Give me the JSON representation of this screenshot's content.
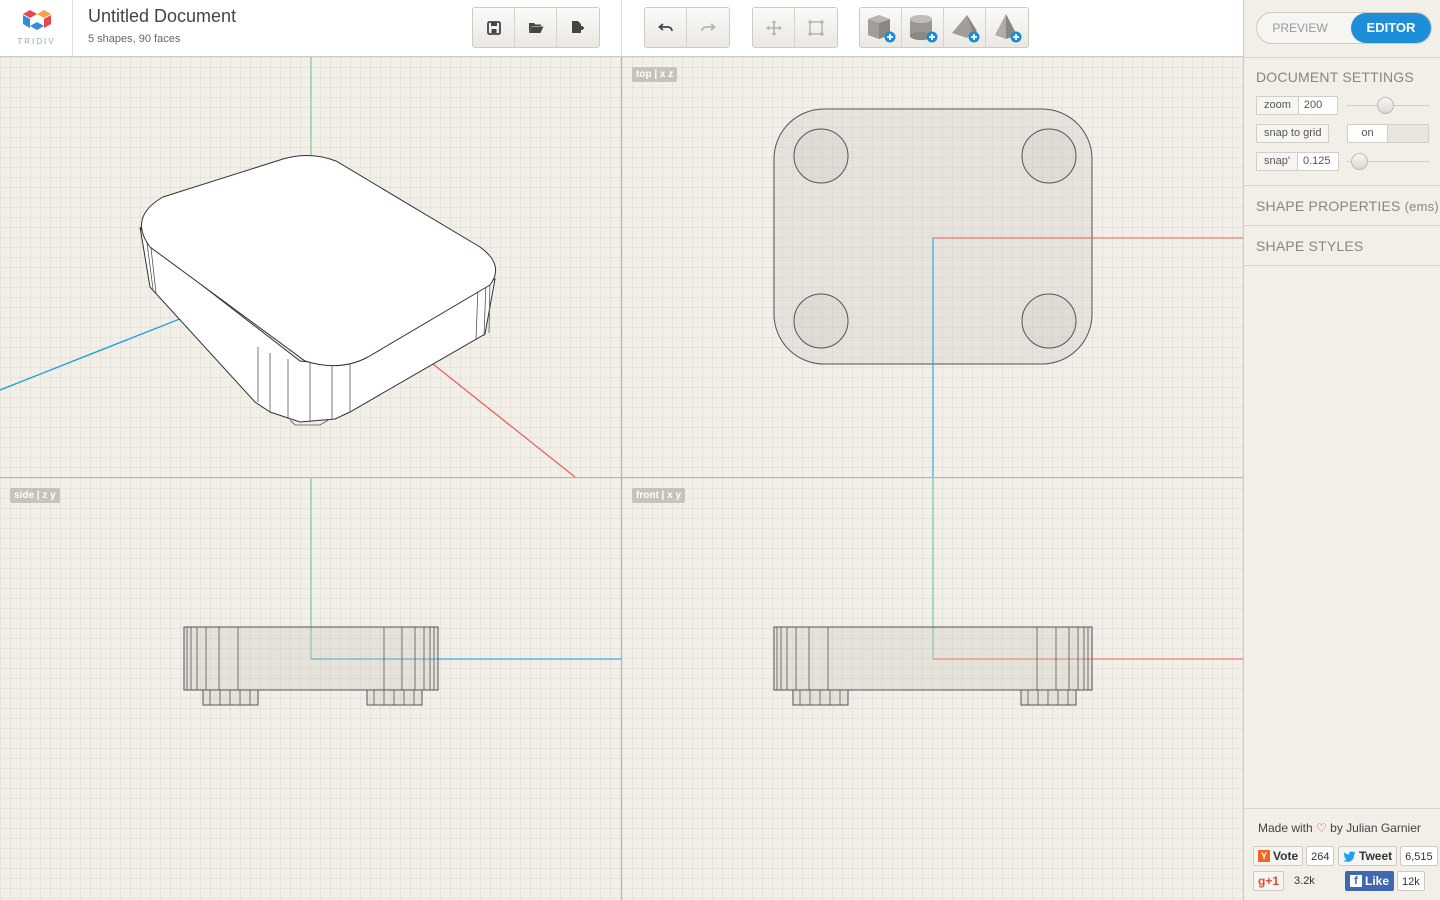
{
  "app": {
    "logo_text": "TRIDIV",
    "document_title": "Untitled Document",
    "document_subtitle": "5 shapes, 90 faces"
  },
  "toolbar": {
    "file_buttons": [
      "save-icon",
      "open-folder-icon",
      "new-document-icon"
    ],
    "history_buttons": [
      "undo-icon",
      "redo-icon"
    ],
    "transform_buttons": [
      "move-icon",
      "resize-icon"
    ],
    "shape_buttons": [
      "add-cube-icon",
      "add-cylinder-icon",
      "add-prism-icon",
      "add-pyramid-icon"
    ]
  },
  "viewports": {
    "perspective": {
      "label": ""
    },
    "top": {
      "label": "top | x z"
    },
    "side": {
      "label": "side | z y"
    },
    "front": {
      "label": "front | x y"
    }
  },
  "sidebar": {
    "mode_preview": "PREVIEW",
    "mode_editor": "EDITOR",
    "document_settings": {
      "heading": "DOCUMENT SETTINGS",
      "zoom_label": "zoom",
      "zoom_value": "200",
      "snap_to_grid_label": "snap to grid",
      "snap_to_grid_value": "on",
      "snap_label": "snap'",
      "snap_value": "0.125"
    },
    "shape_properties_heading": "SHAPE PROPERTIES",
    "shape_properties_unit": "(ems)",
    "shape_styles_heading": "SHAPE STYLES"
  },
  "footer": {
    "made_with": "Made with",
    "heart": "♡",
    "by": "by Julian Garnier",
    "vote_label": "Vote",
    "vote_count": "264",
    "tweet_label": "Tweet",
    "tweet_count": "6,515",
    "gplus_label": "g+1",
    "gplus_count": "3.2k",
    "like_label": "Like",
    "like_count": "12k"
  },
  "colors": {
    "accent": "#1c8fd8",
    "axis_x": "#f0635a",
    "axis_y": "#5cc98a",
    "axis_z": "#1a9ee0",
    "background": "#f2efe9"
  }
}
